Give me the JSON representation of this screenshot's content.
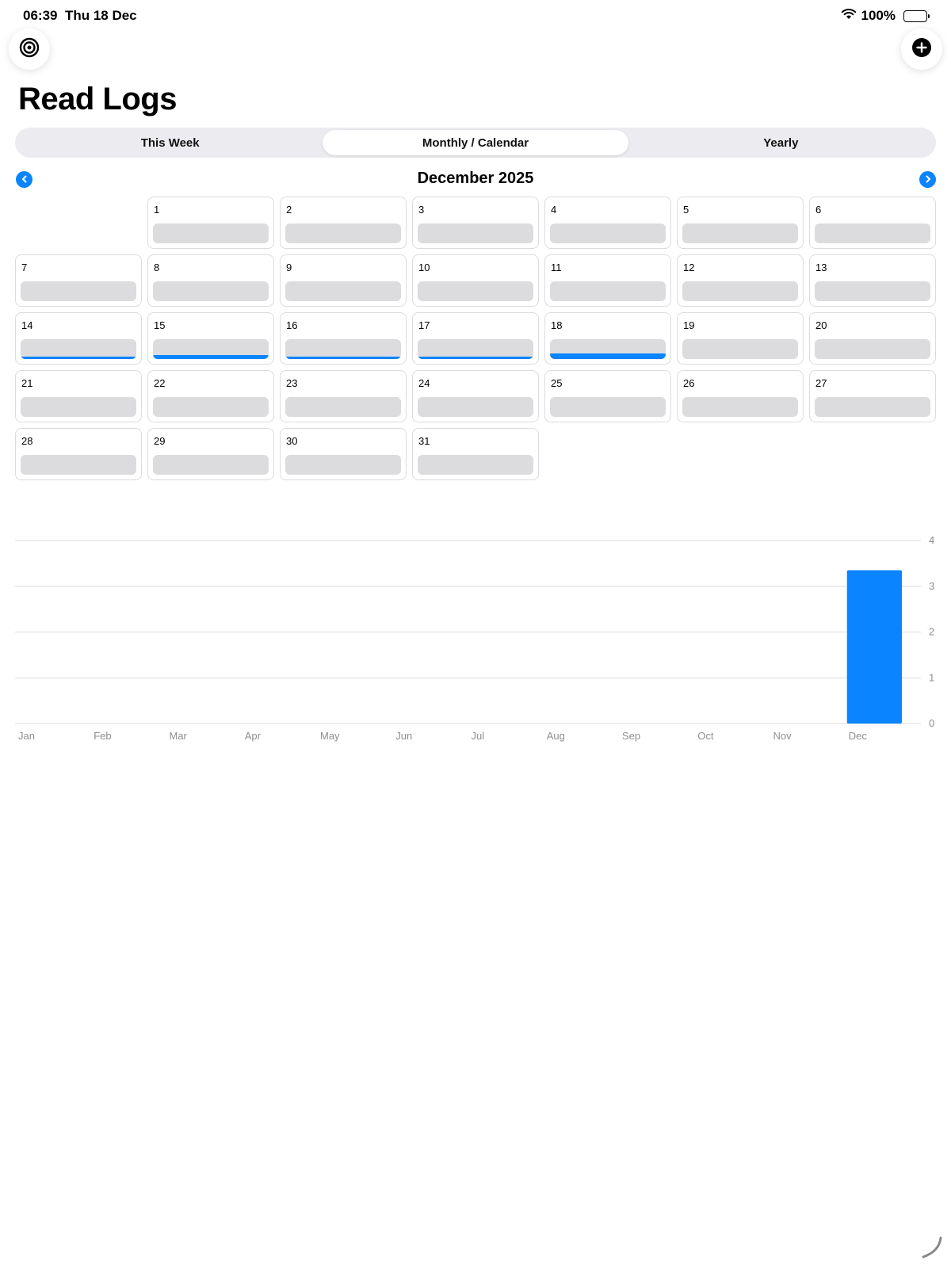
{
  "status_bar": {
    "time": "06:39",
    "date": "Thu 18 Dec",
    "battery": "100%"
  },
  "header": {
    "title": "Read Logs",
    "icons": {
      "left": "target-icon",
      "right": "plus-circle-icon"
    }
  },
  "tabs": [
    {
      "label": "This Week",
      "active": false
    },
    {
      "label": "Monthly / Calendar",
      "active": true
    },
    {
      "label": "Yearly",
      "active": false
    }
  ],
  "calendar": {
    "month_label": "December 2025",
    "leading_blanks": 1,
    "days": [
      {
        "day": "1",
        "progress": 0
      },
      {
        "day": "2",
        "progress": 0
      },
      {
        "day": "3",
        "progress": 0
      },
      {
        "day": "4",
        "progress": 0
      },
      {
        "day": "5",
        "progress": 0
      },
      {
        "day": "6",
        "progress": 0
      },
      {
        "day": "7",
        "progress": 0
      },
      {
        "day": "8",
        "progress": 0
      },
      {
        "day": "9",
        "progress": 0
      },
      {
        "day": "10",
        "progress": 0
      },
      {
        "day": "11",
        "progress": 0
      },
      {
        "day": "12",
        "progress": 0
      },
      {
        "day": "13",
        "progress": 0
      },
      {
        "day": "14",
        "progress": 0.12
      },
      {
        "day": "15",
        "progress": 0.2
      },
      {
        "day": "16",
        "progress": 0.12
      },
      {
        "day": "17",
        "progress": 0.12
      },
      {
        "day": "18",
        "progress": 0.3
      },
      {
        "day": "19",
        "progress": 0
      },
      {
        "day": "20",
        "progress": 0
      },
      {
        "day": "21",
        "progress": 0
      },
      {
        "day": "22",
        "progress": 0
      },
      {
        "day": "23",
        "progress": 0
      },
      {
        "day": "24",
        "progress": 0
      },
      {
        "day": "25",
        "progress": 0
      },
      {
        "day": "26",
        "progress": 0
      },
      {
        "day": "27",
        "progress": 0
      },
      {
        "day": "28",
        "progress": 0
      },
      {
        "day": "29",
        "progress": 0
      },
      {
        "day": "30",
        "progress": 0
      },
      {
        "day": "31",
        "progress": 0
      }
    ]
  },
  "colors": {
    "accent": "#0a84ff",
    "track": "#dcdcdf",
    "grid": "#dcdcdf",
    "axis_text": "#8e8e93"
  },
  "chart_data": {
    "type": "bar",
    "categories": [
      "Jan",
      "Feb",
      "Mar",
      "Apr",
      "May",
      "Jun",
      "Jul",
      "Aug",
      "Sep",
      "Oct",
      "Nov",
      "Dec"
    ],
    "values": [
      0,
      0,
      0,
      0,
      0,
      0,
      0,
      0,
      0,
      0,
      0,
      3.35
    ],
    "y_ticks": [
      "0",
      "1",
      "2",
      "3",
      "4"
    ],
    "ylim": [
      0,
      4
    ],
    "grid": true,
    "y_axis_position": "right"
  }
}
